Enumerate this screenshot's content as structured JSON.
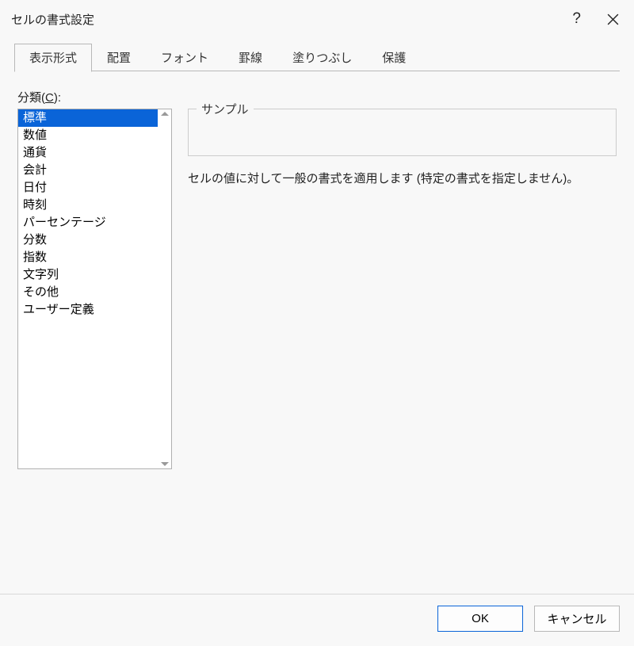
{
  "dialog": {
    "title": "セルの書式設定",
    "help_tooltip": "ヘルプ",
    "close_tooltip": "閉じる"
  },
  "tabs": {
    "items": [
      {
        "label": "表示形式",
        "active": true
      },
      {
        "label": "配置",
        "active": false
      },
      {
        "label": "フォント",
        "active": false
      },
      {
        "label": "罫線",
        "active": false
      },
      {
        "label": "塗りつぶし",
        "active": false
      },
      {
        "label": "保護",
        "active": false
      }
    ]
  },
  "number_tab": {
    "category_label_pre": "分類(",
    "category_label_accel": "C",
    "category_label_post": "):",
    "categories": [
      {
        "label": "標準",
        "selected": true
      },
      {
        "label": "数値",
        "selected": false
      },
      {
        "label": "通貨",
        "selected": false
      },
      {
        "label": "会計",
        "selected": false
      },
      {
        "label": "日付",
        "selected": false
      },
      {
        "label": "時刻",
        "selected": false
      },
      {
        "label": "パーセンテージ",
        "selected": false
      },
      {
        "label": "分数",
        "selected": false
      },
      {
        "label": "指数",
        "selected": false
      },
      {
        "label": "文字列",
        "selected": false
      },
      {
        "label": "その他",
        "selected": false
      },
      {
        "label": "ユーザー定義",
        "selected": false
      }
    ],
    "sample_label": "サンプル",
    "sample_value": "",
    "description": "セルの値に対して一般の書式を適用します (特定の書式を指定しません)。"
  },
  "buttons": {
    "ok": "OK",
    "cancel": "キャンセル"
  }
}
